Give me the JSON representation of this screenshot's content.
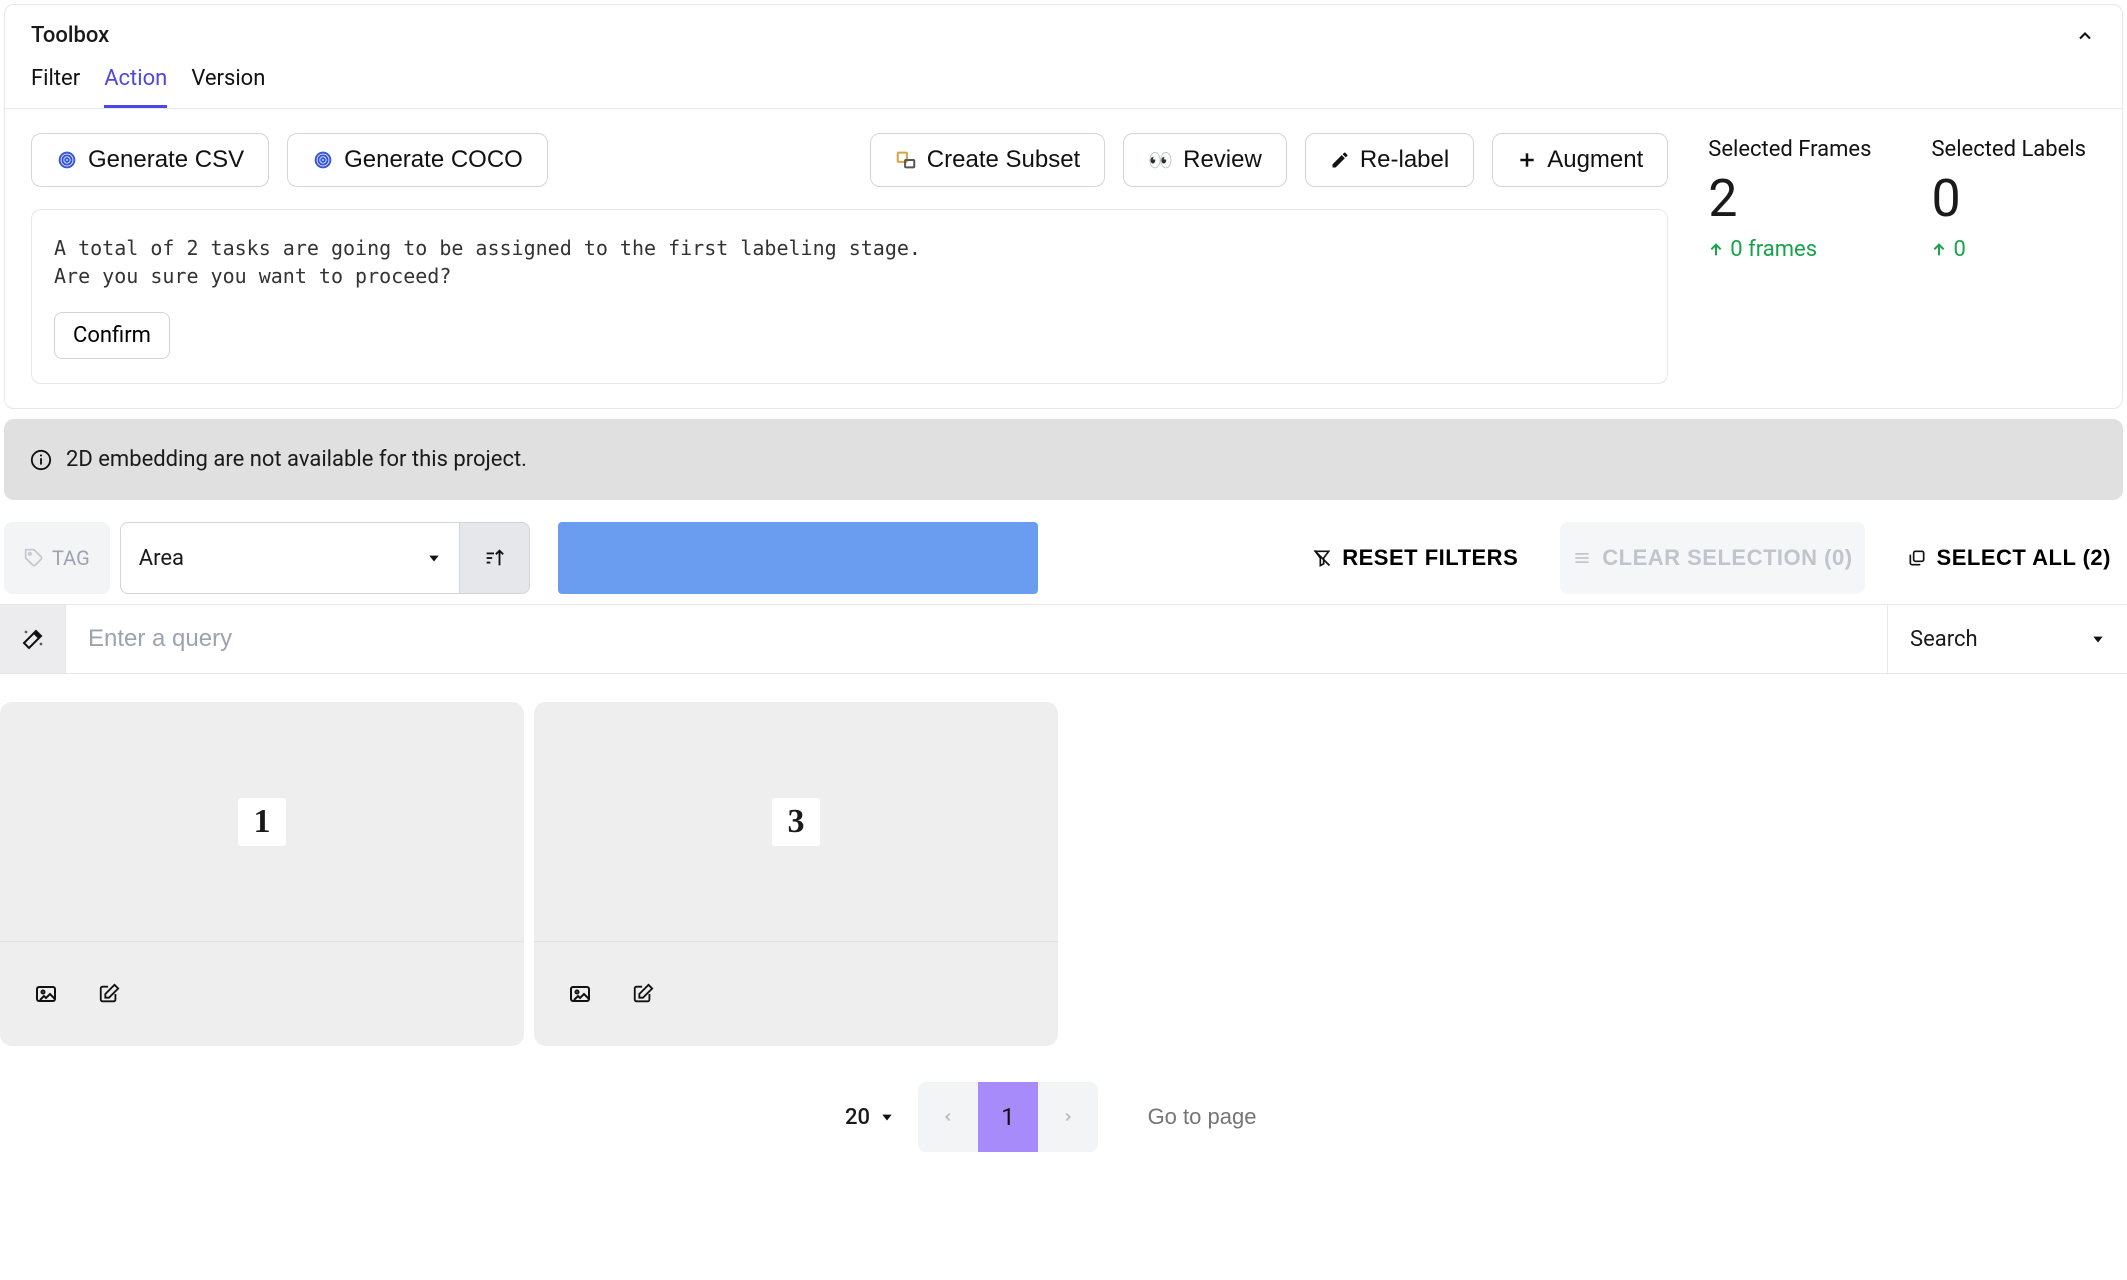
{
  "toolbox": {
    "title": "Toolbox",
    "tabs": {
      "filter": "Filter",
      "action": "Action",
      "version": "Version"
    },
    "buttons": {
      "generate_csv": "Generate CSV",
      "generate_coco": "Generate COCO",
      "create_subset": "Create Subset",
      "review": "Review",
      "relabel": "Re-label",
      "augment": "Augment"
    },
    "message": {
      "line1": "A total of 2 tasks are going to be assigned to the first labeling stage.",
      "line2": "Are you sure you want to proceed?",
      "confirm": "Confirm"
    },
    "stats": {
      "frames_label": "Selected Frames",
      "frames_value": "2",
      "frames_delta": "0 frames",
      "labels_label": "Selected Labels",
      "labels_value": "0",
      "labels_delta": "0"
    }
  },
  "banner": {
    "text": "2D embedding are not available for this project."
  },
  "filterbar": {
    "tag": "TAG",
    "area": "Area",
    "reset": "RESET FILTERS",
    "clear": "CLEAR SELECTION (0)",
    "select_all": "SELECT ALL (2)"
  },
  "search": {
    "placeholder": "Enter a query",
    "mode": "Search"
  },
  "cards": [
    {
      "glyph": "1"
    },
    {
      "glyph": "3"
    }
  ],
  "pagination": {
    "page_size": "20",
    "current": "1",
    "goto_placeholder": "Go to page"
  }
}
